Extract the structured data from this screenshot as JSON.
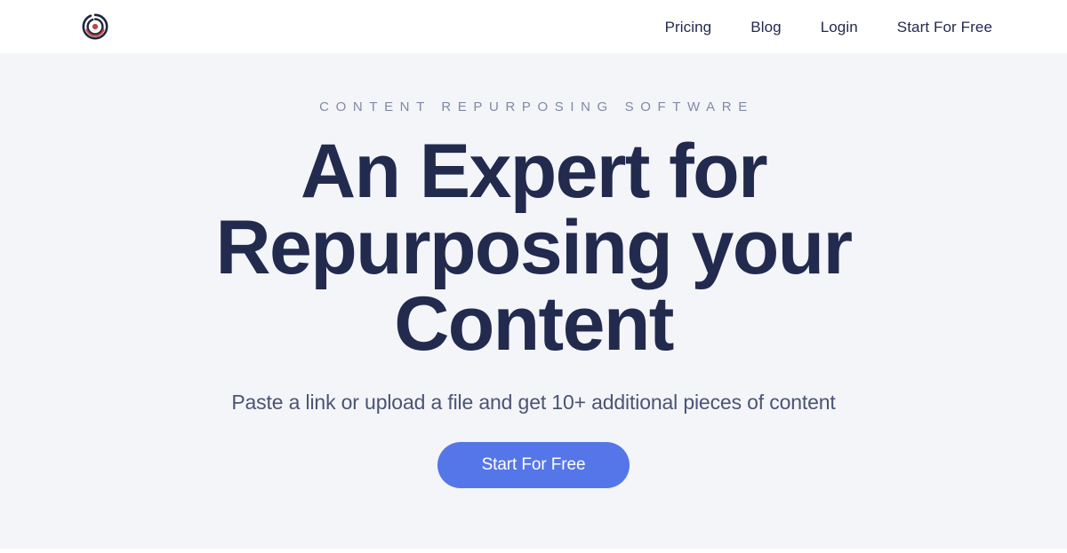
{
  "theme": {
    "header_bg": "#ffffff",
    "hero_bg": "#f3f5f9",
    "navy": "#222a4e",
    "muted_text": "#4b5473",
    "eyebrow_text": "#828aa6",
    "accent_blue": "#5576e8",
    "logo_dark": "#20253f",
    "logo_red": "#c0453f"
  },
  "header": {
    "logo": {
      "icon": "concentric-target-logo-icon",
      "alt": "Brand logo"
    },
    "nav": [
      {
        "id": "pricing",
        "label": "Pricing",
        "href": "#pricing"
      },
      {
        "id": "blog",
        "label": "Blog",
        "href": "#blog"
      },
      {
        "id": "login",
        "label": "Login",
        "href": "#login"
      },
      {
        "id": "start-for-free",
        "label": "Start For Free",
        "href": "#signup"
      }
    ]
  },
  "hero": {
    "eyebrow": "CONTENT REPURPOSING SOFTWARE",
    "title": "An Expert for Repurposing your Content",
    "subtitle": "Paste a link or upload a file and get 10+ additional pieces of content",
    "cta_label": "Start For Free"
  }
}
